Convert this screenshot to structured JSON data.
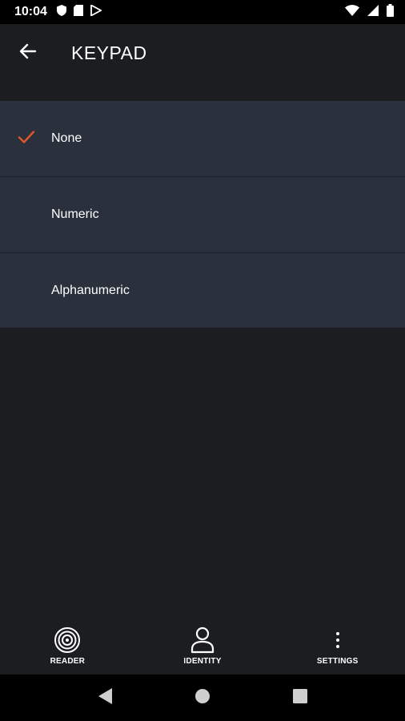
{
  "status_bar": {
    "time": "10:04",
    "left_icons": [
      "shield-icon",
      "sd-card-icon",
      "play-store-icon"
    ],
    "right_icons": [
      "wifi-icon",
      "signal-icon",
      "battery-icon"
    ]
  },
  "app_bar": {
    "title": "KEYPAD",
    "back_icon": "arrow-left-icon"
  },
  "options": [
    {
      "label": "None",
      "selected": true
    },
    {
      "label": "Numeric",
      "selected": false
    },
    {
      "label": "Alphanumeric",
      "selected": false
    }
  ],
  "bottom_nav": [
    {
      "label": "READER",
      "icon": "target-icon"
    },
    {
      "label": "IDENTITY",
      "icon": "person-icon"
    },
    {
      "label": "SETTINGS",
      "icon": "more-vert-icon"
    }
  ],
  "colors": {
    "background": "#1b1d21",
    "list_item": "#2a313d",
    "check_accent": "#e0562b"
  }
}
